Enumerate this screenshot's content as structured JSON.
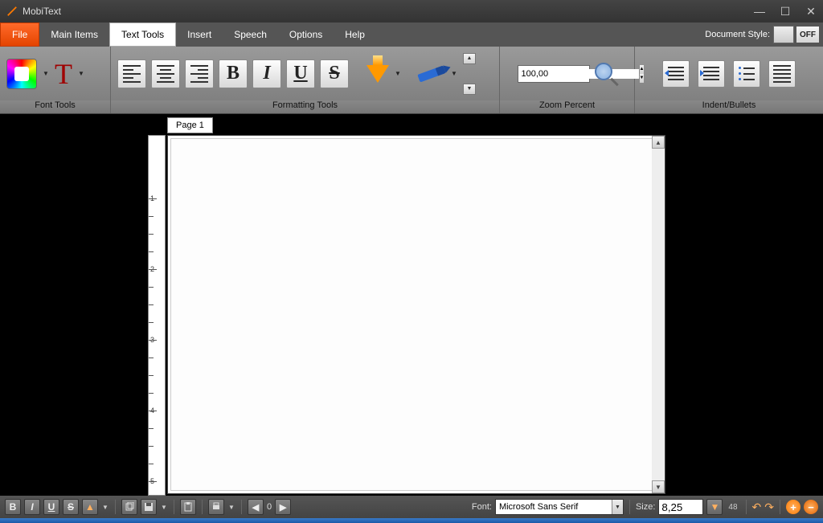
{
  "titlebar": {
    "title": "MobiText"
  },
  "menu": {
    "file": "File",
    "main_items": "Main Items",
    "text_tools": "Text Tools",
    "insert": "Insert",
    "speech": "Speech",
    "options": "Options",
    "help": "Help",
    "doc_style_label": "Document Style:",
    "doc_style_off": "OFF"
  },
  "ribbon": {
    "font_tools_label": "Font Tools",
    "formatting_label": "Formatting Tools",
    "zoom_label": "Zoom Percent",
    "indent_label": "Indent/Bullets",
    "bold": "B",
    "italic": "I",
    "underline": "U",
    "strike": "S",
    "zoom_value": "100,00"
  },
  "workspace": {
    "page_tab": "Page 1",
    "ruler_marks": [
      "1",
      "2",
      "3",
      "4",
      "5"
    ]
  },
  "statusbar": {
    "bold": "B",
    "italic": "I",
    "underline": "U",
    "strike": "S",
    "count": "0",
    "font_label": "Font:",
    "font_value": "Microsoft Sans Serif",
    "size_label": "Size:",
    "size_value": "8,25",
    "status_num": "48"
  }
}
